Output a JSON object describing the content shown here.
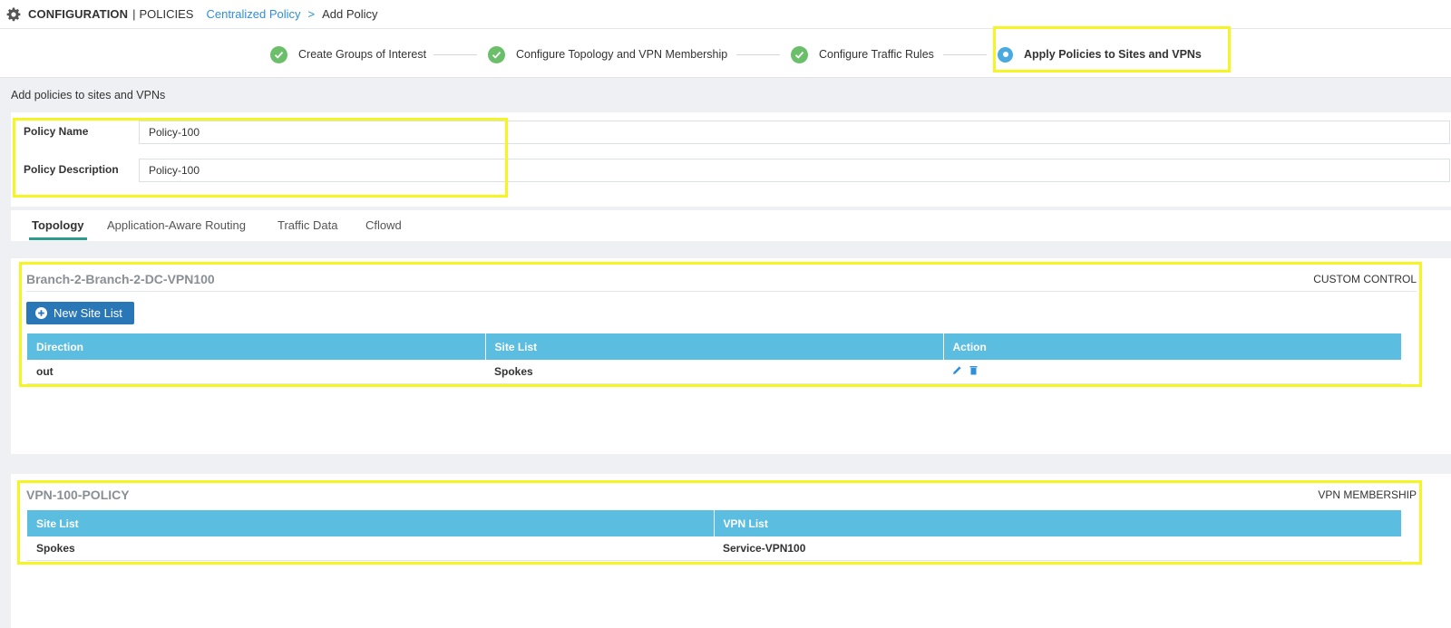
{
  "header": {
    "section": "CONFIGURATION",
    "separator": "|",
    "page": "POLICIES",
    "breadcrumb_link": "Centralized Policy",
    "breadcrumb_arrow": ">",
    "breadcrumb_current": "Add Policy"
  },
  "wizard": {
    "steps": [
      {
        "label": "Create Groups of Interest",
        "state": "done"
      },
      {
        "label": "Configure Topology and VPN Membership",
        "state": "done"
      },
      {
        "label": "Configure Traffic Rules",
        "state": "done"
      },
      {
        "label": "Apply Policies to Sites and VPNs",
        "state": "current"
      }
    ]
  },
  "main": {
    "section_title": "Add policies to sites and VPNs",
    "policy_name_label": "Policy Name",
    "policy_name_value": "Policy-100",
    "policy_description_label": "Policy Description",
    "policy_description_value": "Policy-100"
  },
  "tabs": [
    {
      "label": "Topology",
      "active": true
    },
    {
      "label": "Application-Aware Routing",
      "active": false
    },
    {
      "label": "Traffic Data",
      "active": false
    },
    {
      "label": "Cflowd",
      "active": false
    }
  ],
  "topology_panel": {
    "title": "Branch-2-Branch-2-DC-VPN100",
    "type": "CUSTOM CONTROL",
    "new_button_label": "New Site List",
    "columns": [
      "Direction",
      "Site List",
      "Action"
    ],
    "rows": [
      {
        "direction": "out",
        "site_list": "Spokes"
      }
    ]
  },
  "vpn_panel": {
    "title": "VPN-100-POLICY",
    "type": "VPN MEMBERSHIP",
    "columns": [
      "Site List",
      "VPN List"
    ],
    "rows": [
      {
        "site_list": "Spokes",
        "vpn_list": "Service-VPN100"
      }
    ]
  },
  "colors": {
    "table_header": "#5bbde0",
    "primary_button": "#2a77b8",
    "done_step": "#6cbf6a",
    "current_step": "#4aa9df",
    "breadcrumb_link": "#2f8fd8",
    "highlight_box": "#f5f523",
    "active_tab_underline": "#2a9d8f"
  },
  "icons": {
    "header": "gear-icon",
    "done_step": "check-circle-icon",
    "current_step": "radio-current-icon",
    "new_button": "plus-circle-icon",
    "edit": "pencil-icon",
    "delete": "trash-icon"
  }
}
